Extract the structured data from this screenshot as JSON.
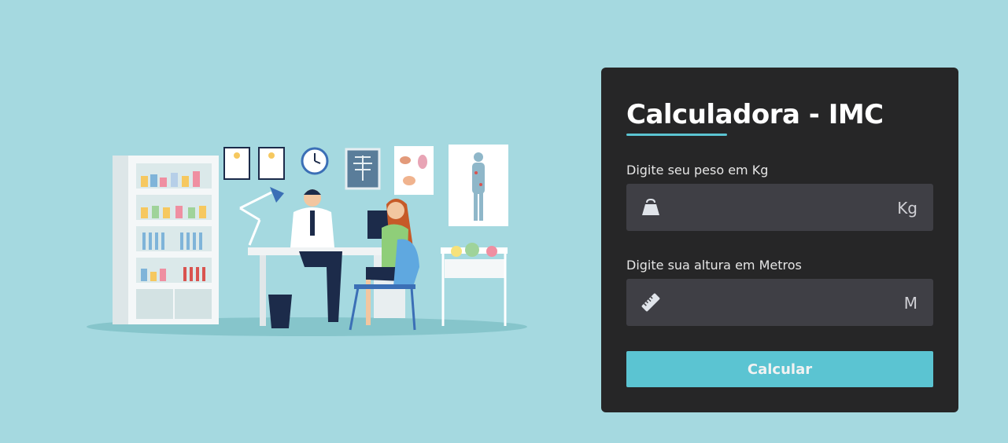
{
  "illustration": {
    "icon": "doctor-consultation-illustration"
  },
  "calculator": {
    "title": "Calculadora - IMC",
    "weight": {
      "label": "Digite seu peso em Kg",
      "value": "",
      "placeholder": "",
      "unit": "Kg",
      "icon": "weight-icon"
    },
    "height": {
      "label": "Digite sua altura em Metros",
      "value": "",
      "placeholder": "",
      "unit": "M",
      "icon": "ruler-icon"
    },
    "button_label": "Calcular"
  },
  "colors": {
    "background": "#a5d9e0",
    "card": "#262627",
    "field": "#3f3f45",
    "accent": "#5bc4d2"
  }
}
